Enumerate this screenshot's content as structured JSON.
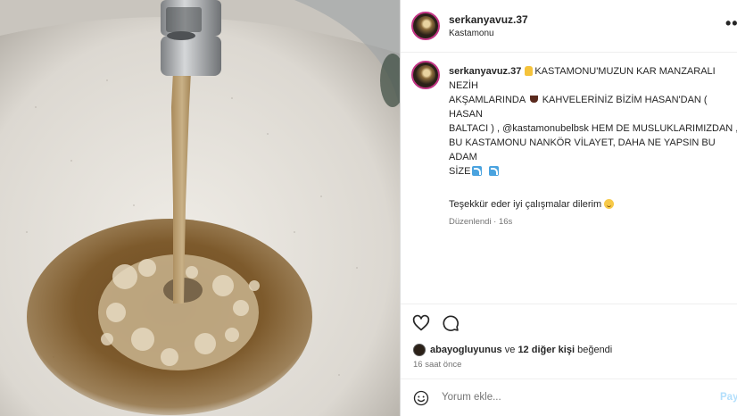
{
  "post": {
    "username": "serkanyavuz.37",
    "location": "Kastamonu",
    "more_icon": "more-icon"
  },
  "caption": {
    "username": "serkanyavuz.37",
    "line1": "KASTAMONU'MUZUN KAR MANZARALI NEZİH",
    "line2a": "AKŞAMLARINDA",
    "line2b": "KAHVELERİNİZ BİZİM HASAN'DAN ( HASAN",
    "line3": "BALTACI ) , @kastamonubelbsk HEM DE MUSLUKLARIMIZDAN ,",
    "line4": "BU KASTAMONU NANKÖR VİLAYET, DAHA NE YAPSIN BU ADAM",
    "line5": "SİZE",
    "thanks": "Teşekkür eder iyi çalışmalar dilerim",
    "edited": "Düzenlendi · 16s"
  },
  "likes": {
    "liker": "abayogluyunus",
    "connector": "ve",
    "others": "12 diğer kişi",
    "suffix": "beğendi"
  },
  "time_ago": "16 saat önce",
  "comment": {
    "placeholder": "Yorum ekle...",
    "post_label": "Paylaş"
  },
  "colors": {
    "link": "#0095f6",
    "muted": "#737373",
    "water": "#8a6a3a"
  }
}
